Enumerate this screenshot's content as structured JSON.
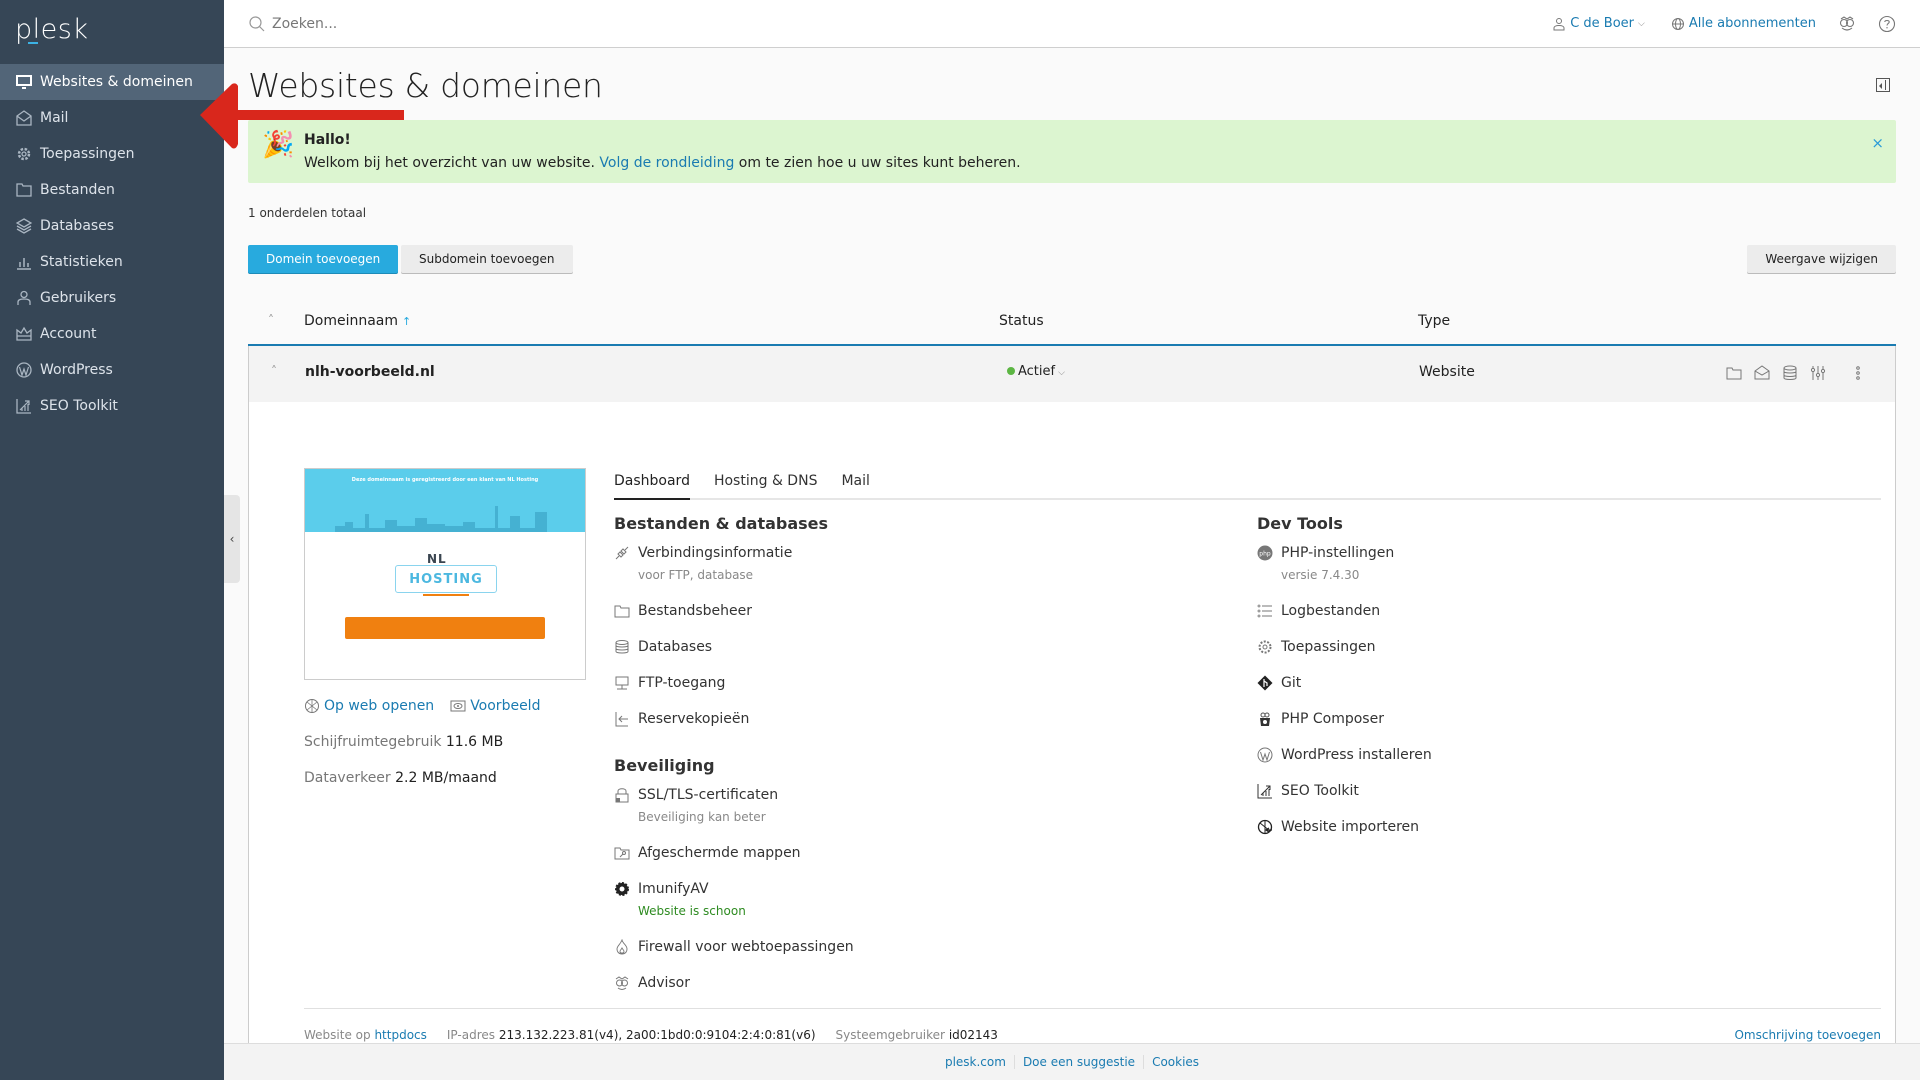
{
  "app": {
    "logo": "plesk"
  },
  "sidebar": {
    "items": [
      {
        "label": "Websites & domeinen",
        "icon": "monitor-icon",
        "active": true
      },
      {
        "label": "Mail",
        "icon": "mail-icon"
      },
      {
        "label": "Toepassingen",
        "icon": "gear-icon"
      },
      {
        "label": "Bestanden",
        "icon": "folder-icon"
      },
      {
        "label": "Databases",
        "icon": "layers-icon"
      },
      {
        "label": "Statistieken",
        "icon": "bar-chart-icon"
      },
      {
        "label": "Gebruikers",
        "icon": "user-icon"
      },
      {
        "label": "Account",
        "icon": "crown-icon"
      },
      {
        "label": "WordPress",
        "icon": "wordpress-icon"
      },
      {
        "label": "SEO Toolkit",
        "icon": "seo-chart-icon"
      }
    ]
  },
  "header": {
    "search_placeholder": "Zoeken...",
    "user": "C de Boer",
    "subscriptions": "Alle abonnementen"
  },
  "page": {
    "title": "Websites & domeinen"
  },
  "banner": {
    "title": "Hallo!",
    "text_before": "Welkom bij het overzicht van uw website. ",
    "link": "Volg de rondleiding",
    "text_after": " om te zien hoe u uw sites kunt beheren.",
    "close": "×"
  },
  "list": {
    "total": "1 onderdelen totaal",
    "add_domain": "Domein toevoegen",
    "add_subdomain": "Subdomein toevoegen",
    "change_view": "Weergave wijzigen",
    "columns": {
      "domain": "Domeinnaam",
      "status": "Status",
      "type": "Type"
    }
  },
  "domain": {
    "name": "nlh-voorbeeld.nl",
    "status": "Actief",
    "status_color": "#5cb643",
    "type": "Website",
    "preview": {
      "headline": "Deze domeinnaam is geregistreerd door een klant van NL Hosting",
      "logo_top": "NL",
      "logo_bottom": "HOSTING"
    },
    "open_web": "Op web openen",
    "preview_link": "Voorbeeld",
    "disk_label": "Schijfruimtegebruik",
    "disk_value": "11.6 MB",
    "traffic_label": "Dataverkeer",
    "traffic_value": "2.2 MB/maand",
    "tabs": [
      "Dashboard",
      "Hosting & DNS",
      "Mail"
    ],
    "sections": {
      "files": {
        "title": "Bestanden & databases",
        "items": [
          {
            "label": "Verbindingsinformatie",
            "sub": "voor FTP, database"
          },
          {
            "label": "Bestandsbeheer"
          },
          {
            "label": "Databases"
          },
          {
            "label": "FTP-toegang"
          },
          {
            "label": "Reservekopieën"
          }
        ]
      },
      "security": {
        "title": "Beveiliging",
        "items": [
          {
            "label": "SSL/TLS-certificaten",
            "sub": "Beveiliging kan beter"
          },
          {
            "label": "Afgeschermde mappen"
          },
          {
            "label": "ImunifyAV",
            "sub": "Website is schoon"
          },
          {
            "label": "Firewall voor webtoepassingen"
          },
          {
            "label": "Advisor"
          }
        ]
      },
      "dev": {
        "title": "Dev Tools",
        "items": [
          {
            "label": "PHP-instellingen",
            "sub": "versie 7.4.30"
          },
          {
            "label": "Logbestanden"
          },
          {
            "label": "Toepassingen"
          },
          {
            "label": "Git"
          },
          {
            "label": "PHP Composer"
          },
          {
            "label": "WordPress installeren"
          },
          {
            "label": "SEO Toolkit"
          },
          {
            "label": "Website importeren"
          }
        ]
      }
    },
    "footer": {
      "website_label": "Website op",
      "website_value": "httpdocs",
      "ip_label": "IP-adres",
      "ip_value": "213.132.223.81(v4), 2a00:1bd0:0:9104:2:4:0:81(v6)",
      "sysuser_label": "Systeemgebruiker",
      "sysuser_value": "id02143",
      "add_description": "Omschrijving toevoegen"
    }
  },
  "footer": {
    "links": [
      "plesk.com",
      "Doe een suggestie",
      "Cookies"
    ]
  },
  "colors": {
    "sidebar": "#364656",
    "accent": "#1a7bb1",
    "primary_button": "#28aade",
    "banner": "#dcf5d0",
    "annotation_arrow": "#d9271c"
  }
}
